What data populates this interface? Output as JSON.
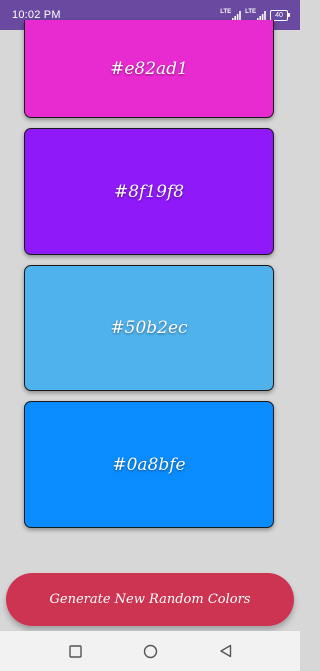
{
  "status_bar": {
    "time": "10:02 PM",
    "network_1": "LTE",
    "network_2": "LTE",
    "battery": "40"
  },
  "swatches": [
    {
      "hex": "#e82ad1",
      "label": "#e82ad1"
    },
    {
      "hex": "#8f19f8",
      "label": "#8f19f8"
    },
    {
      "hex": "#50b2ec",
      "label": "#50b2ec"
    },
    {
      "hex": "#0a8bfe",
      "label": "#0a8bfe"
    }
  ],
  "generate_button": {
    "label": "Generate New Random Colors",
    "color": "#cc3451"
  },
  "nav_bar": {
    "recent_icon": "square-icon",
    "home_icon": "circle-icon",
    "back_icon": "triangle-back-icon"
  },
  "colors": {
    "status_bar": "#6a4aa0",
    "background": "#d7d7d7"
  }
}
